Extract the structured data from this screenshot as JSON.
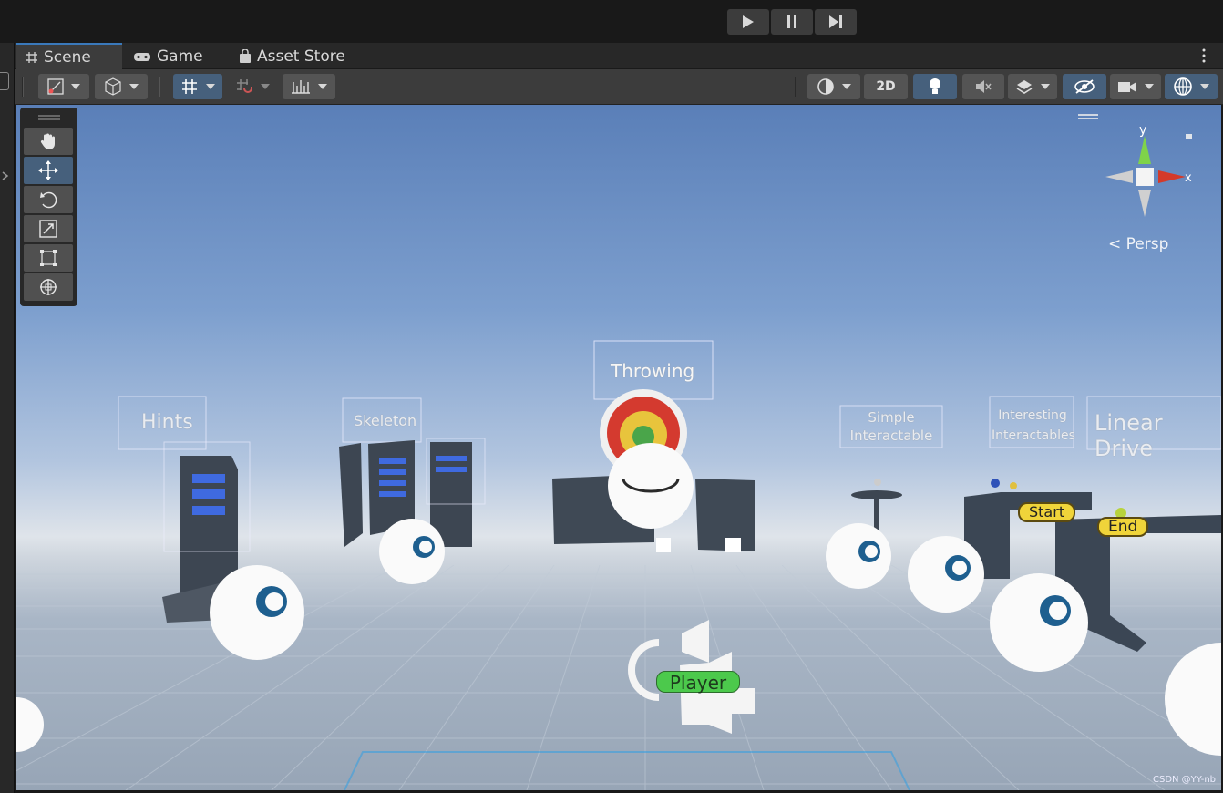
{
  "play_controls": {
    "play": "play-icon",
    "pause": "pause-icon",
    "step": "step-icon"
  },
  "tabs": [
    {
      "label": "Scene",
      "icon": "grid-icon",
      "active": true
    },
    {
      "label": "Game",
      "icon": "gamepad-icon",
      "active": false
    },
    {
      "label": "Asset Store",
      "icon": "bag-icon",
      "active": false
    }
  ],
  "toolbar": {
    "toggle_2d": "2D",
    "left_tools": [
      "draw-mode-icon",
      "shading-cube-icon",
      "grid-snap-icon",
      "increment-snap-icon",
      "ruler-icon"
    ],
    "right_tools": [
      "render-mode-icon",
      "lighting-icon",
      "audio-mute-icon",
      "effects-icon",
      "hidden-objects-icon",
      "camera-icon",
      "gizmos-icon"
    ]
  },
  "tool_palette": [
    "hand-tool",
    "move-tool",
    "rotate-tool",
    "scale-tool",
    "rect-tool",
    "transform-tool"
  ],
  "gizmo": {
    "y_label": "y",
    "x_label": "x",
    "projection": "Persp"
  },
  "scene": {
    "labels": {
      "hints": "Hints",
      "skeleton": "Skeleton",
      "throwing": "Throwing",
      "simple": "Simple\nInteractable",
      "interesting": "Interesting\nInteractables",
      "linear": "Linear Drive"
    },
    "start": "Start",
    "end": "End",
    "player": "Player",
    "watermark": "CSDN @YY-nb"
  },
  "colors": {
    "accent": "#3a79bb",
    "toggle_active": "#46607c",
    "player": "#4cc94c",
    "tag": "#f0d43a"
  }
}
